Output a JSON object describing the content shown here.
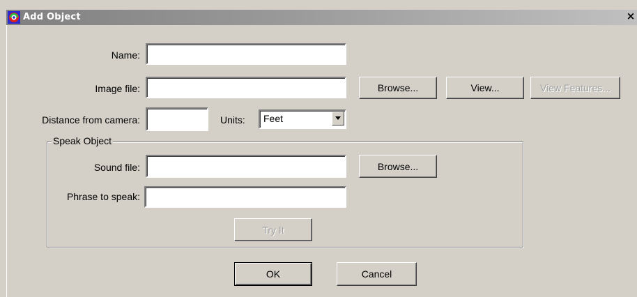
{
  "window": {
    "title": "Add Object",
    "app_icon": "app-logo-icon",
    "close_glyph": "×"
  },
  "form": {
    "name_label": "Name:",
    "name_value": "",
    "image_file_label": "Image file:",
    "image_file_value": "",
    "browse_image_label": "Browse...",
    "view_label": "View...",
    "view_features_label": "View Features...",
    "distance_label": "Distance from camera:",
    "distance_value": "",
    "units_label": "Units:",
    "units_selected": "Feet"
  },
  "speak_group": {
    "title": "Speak Object",
    "sound_file_label": "Sound file:",
    "sound_file_value": "",
    "browse_sound_label": "Browse...",
    "phrase_label": "Phrase to speak:",
    "phrase_value": "",
    "try_it_label": "Try It"
  },
  "footer": {
    "ok_label": "OK",
    "cancel_label": "Cancel"
  },
  "colors": {
    "dialog_bg": "#d4d0c8",
    "titlebar_start": "#808080",
    "titlebar_end": "#c0c0c0",
    "disabled_text": "#a0a0a0"
  }
}
